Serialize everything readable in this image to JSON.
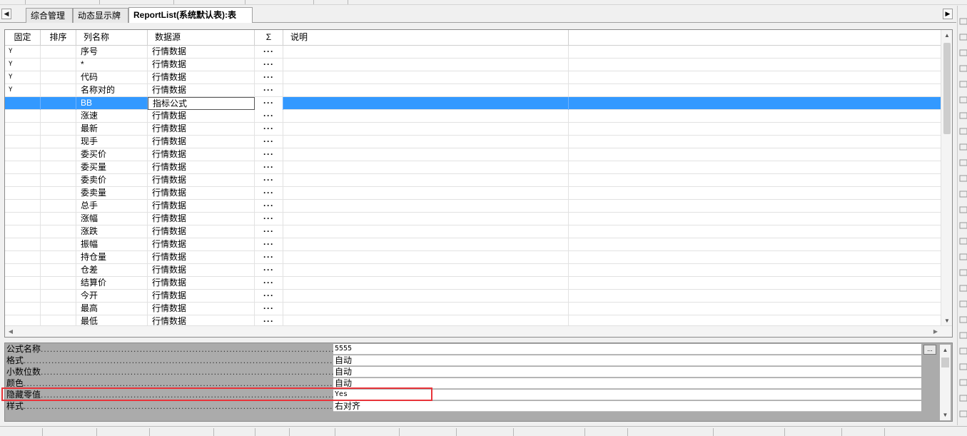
{
  "tabs": [
    {
      "label": "综合管理",
      "active": false
    },
    {
      "label": "动态显示牌",
      "active": false
    },
    {
      "label": "ReportList(系统默认表):表",
      "active": true
    }
  ],
  "nav": {
    "left": "◀",
    "right": "▶"
  },
  "columns": {
    "fixed": "固定",
    "sort": "排序",
    "name": "列名称",
    "source": "数据源",
    "sum": "Σ",
    "desc": "说明"
  },
  "rows": [
    {
      "fixed": "Y",
      "name": "序号",
      "source": "行情数据",
      "sum": "···"
    },
    {
      "fixed": "Y",
      "name": "*",
      "source": "行情数据",
      "sum": "···"
    },
    {
      "fixed": "Y",
      "name": "代码",
      "source": "行情数据",
      "sum": "···"
    },
    {
      "fixed": "Y",
      "name": "名称对的",
      "source": "行情数据",
      "sum": "···"
    },
    {
      "fixed": "",
      "name": "BB",
      "source": "指标公式",
      "sum": "···",
      "selected": true
    },
    {
      "fixed": "",
      "name": "涨速",
      "source": "行情数据",
      "sum": "···"
    },
    {
      "fixed": "",
      "name": "最新",
      "source": "行情数据",
      "sum": "···"
    },
    {
      "fixed": "",
      "name": "现手",
      "source": "行情数据",
      "sum": "···"
    },
    {
      "fixed": "",
      "name": "委买价",
      "source": "行情数据",
      "sum": "···"
    },
    {
      "fixed": "",
      "name": "委买量",
      "source": "行情数据",
      "sum": "···"
    },
    {
      "fixed": "",
      "name": "委卖价",
      "source": "行情数据",
      "sum": "···"
    },
    {
      "fixed": "",
      "name": "委卖量",
      "source": "行情数据",
      "sum": "···"
    },
    {
      "fixed": "",
      "name": "总手",
      "source": "行情数据",
      "sum": "···"
    },
    {
      "fixed": "",
      "name": "涨幅",
      "source": "行情数据",
      "sum": "···"
    },
    {
      "fixed": "",
      "name": "涨跌",
      "source": "行情数据",
      "sum": "···"
    },
    {
      "fixed": "",
      "name": "振幅",
      "source": "行情数据",
      "sum": "···"
    },
    {
      "fixed": "",
      "name": "持仓量",
      "source": "行情数据",
      "sum": "···"
    },
    {
      "fixed": "",
      "name": "仓差",
      "source": "行情数据",
      "sum": "···"
    },
    {
      "fixed": "",
      "name": "结算价",
      "source": "行情数据",
      "sum": "···"
    },
    {
      "fixed": "",
      "name": "今开",
      "source": "行情数据",
      "sum": "···"
    },
    {
      "fixed": "",
      "name": "最高",
      "source": "行情数据",
      "sum": "···"
    },
    {
      "fixed": "",
      "name": "最低",
      "source": "行情数据",
      "sum": "···"
    }
  ],
  "properties": [
    {
      "name": "公式名称",
      "value": "5555",
      "button": "..."
    },
    {
      "name": "格式",
      "value": "自动"
    },
    {
      "name": "小数位数",
      "value": "自动"
    },
    {
      "name": "颜色",
      "value": "自动"
    },
    {
      "name": "隐藏零值",
      "value": "Yes",
      "highlighted": true
    },
    {
      "name": "样式",
      "value": "右对齐"
    }
  ],
  "scroll_arrows": {
    "up": "▲",
    "down": "▼",
    "left": "◀",
    "right": "▶"
  },
  "colors": {
    "selection": "#3399ff",
    "highlight_box": "#e8343a",
    "panel_bg": "#ababab"
  }
}
